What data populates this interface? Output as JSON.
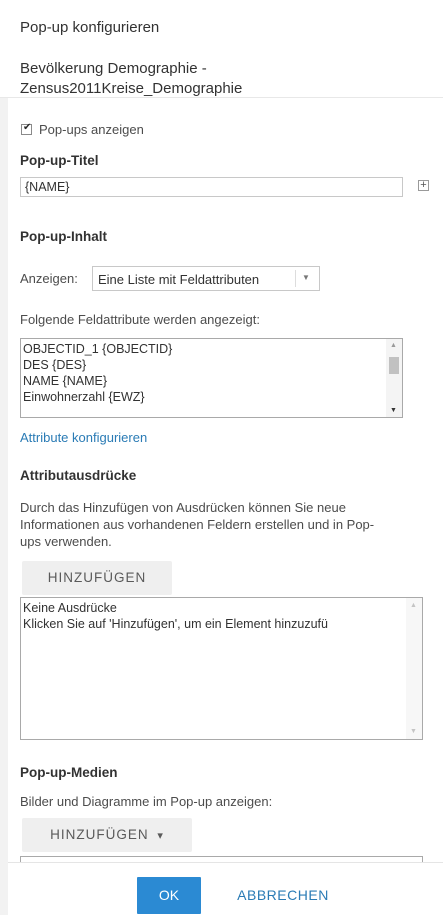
{
  "dialog": {
    "title": "Pop-up konfigurieren",
    "layer_name": "Bevölkerung Demographie - Zensus2011Kreise_Demographie"
  },
  "show_popups": {
    "label": "Pop-ups anzeigen",
    "checked": true,
    "check_glyph": "✔"
  },
  "popup_title": {
    "heading": "Pop-up-Titel",
    "value": "{NAME}",
    "expand_glyph": "+"
  },
  "popup_content": {
    "heading": "Pop-up-Inhalt",
    "display_label": "Anzeigen:",
    "display_value": "Eine Liste mit Feldattributen",
    "fields_label": "Folgende Feldattribute werden angezeigt:",
    "fields": [
      "OBJECTID_1 {OBJECTID}",
      "DES {DES}",
      "NAME {NAME}",
      "Einwohnerzahl {EWZ}"
    ],
    "configure_link": "Attribute konfigurieren"
  },
  "expressions": {
    "heading": "Attributausdrücke",
    "description_lines": [
      "Durch das Hinzufügen von Ausdrücken können Sie neue",
      "Informationen aus vorhandenen Feldern erstellen und in Pop-",
      "ups verwenden."
    ],
    "add_button": "HINZUFÜGEN",
    "list_lines": [
      "Keine Ausdrücke",
      "Klicken Sie auf 'Hinzufügen', um ein Element hinzuzufü"
    ]
  },
  "media": {
    "heading": "Pop-up-Medien",
    "description": "Bilder und Diagramme im Pop-up anzeigen:",
    "add_button": "HINZUFÜGEN",
    "add_button_arrow": "▾"
  },
  "footer": {
    "ok": "OK",
    "cancel": "ABBRECHEN"
  },
  "colors": {
    "accent": "#2b8ad3",
    "link": "#2a7bb5",
    "button_grey": "#efefef"
  }
}
